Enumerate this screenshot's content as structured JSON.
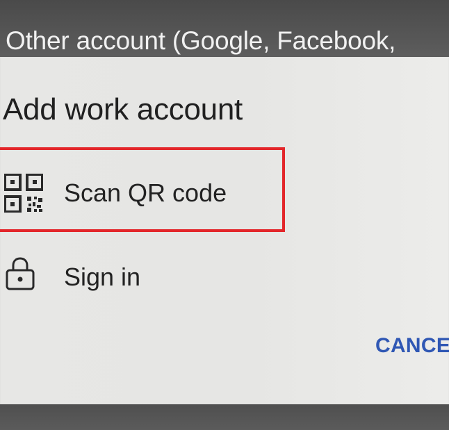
{
  "background": {
    "partial_text": "Other account (Google, Facebook,"
  },
  "dialog": {
    "title": "Add work account",
    "options": [
      {
        "label": "Scan QR code",
        "icon": "qr-code-icon"
      },
      {
        "label": "Sign in",
        "icon": "lock-icon"
      }
    ],
    "cancel_label": "CANCE",
    "highlight_color": "#e3262a",
    "accent_color": "#2f57b4"
  }
}
